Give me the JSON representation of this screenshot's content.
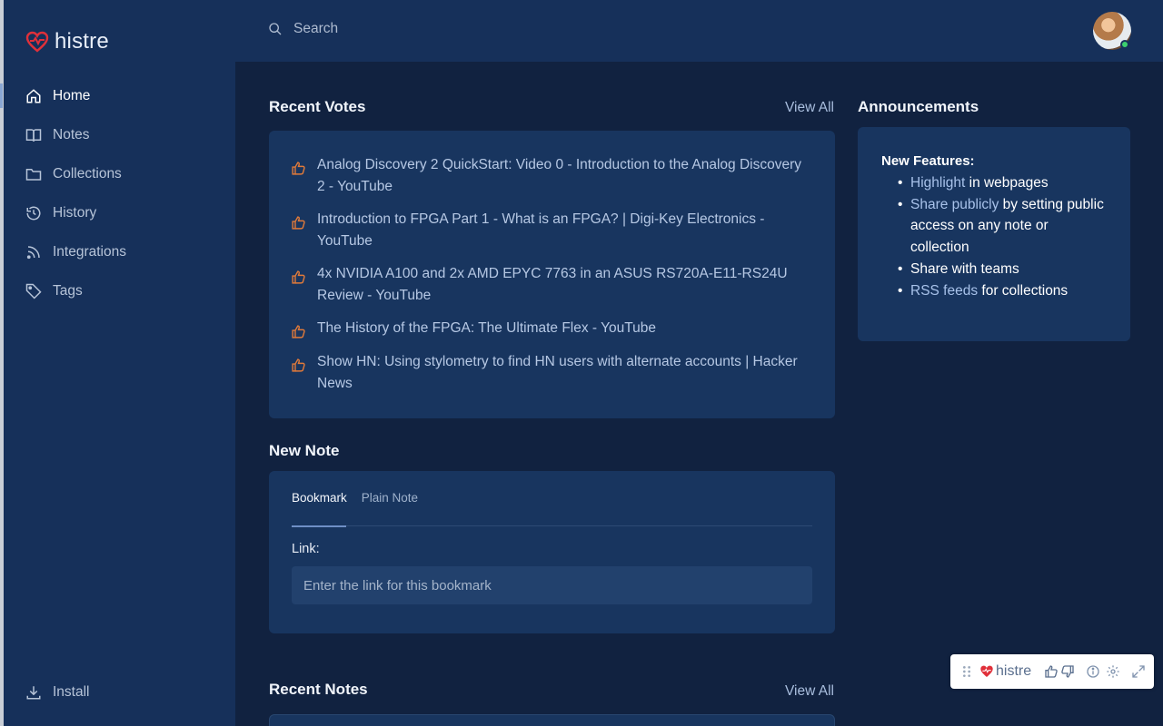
{
  "app": {
    "name": "histre",
    "brand_color": "#e0303a",
    "accent_color": "#e07a3a"
  },
  "sidebar": {
    "items": [
      {
        "label": "Home",
        "icon": "home-icon",
        "active": true
      },
      {
        "label": "Notes",
        "icon": "book-icon",
        "active": false
      },
      {
        "label": "Collections",
        "icon": "folder-icon",
        "active": false
      },
      {
        "label": "History",
        "icon": "history-icon",
        "active": false
      },
      {
        "label": "Integrations",
        "icon": "rss-icon",
        "active": false
      },
      {
        "label": "Tags",
        "icon": "tag-icon",
        "active": false
      }
    ],
    "install_label": "Install"
  },
  "topbar": {
    "search_placeholder": "Search"
  },
  "recent_votes": {
    "title": "Recent Votes",
    "view_all": "View All",
    "items": [
      "Analog Discovery 2 QuickStart: Video 0 - Introduction to the Analog Discovery 2 - YouTube",
      "Introduction to FPGA Part 1 - What is an FPGA? | Digi-Key Electronics - YouTube",
      "4x NVIDIA A100 and 2x AMD EPYC 7763 in an ASUS RS720A-E11-RS24U Review - YouTube",
      "The History of the FPGA: The Ultimate Flex - YouTube",
      "Show HN: Using stylometry to find HN users with alternate accounts | Hacker News"
    ]
  },
  "announcements": {
    "title": "Announcements",
    "heading": "New Features:",
    "items": [
      {
        "link": "Highlight",
        "text": " in webpages"
      },
      {
        "link": "Share publicly",
        "text": " by setting public access on any note or collection"
      },
      {
        "link": "",
        "text": "Share with teams"
      },
      {
        "link": "RSS feeds",
        "text": " for collections"
      }
    ]
  },
  "new_note": {
    "title": "New Note",
    "tabs": [
      "Bookmark",
      "Plain Note"
    ],
    "link_label": "Link:",
    "link_placeholder": "Enter the link for this bookmark"
  },
  "recent_notes": {
    "title": "Recent Notes",
    "view_all": "View All"
  },
  "widget": {
    "label": "histre"
  }
}
